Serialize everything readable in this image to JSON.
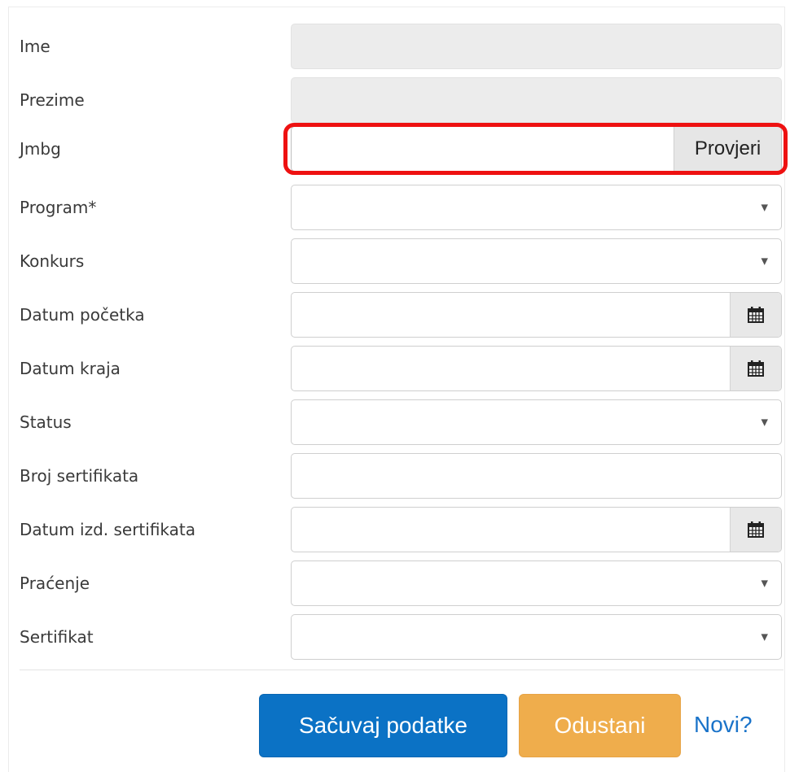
{
  "form": {
    "fields": [
      {
        "label": "Ime",
        "type": "readonly"
      },
      {
        "label": "Prezime",
        "type": "readonly"
      },
      {
        "label": "Jmbg",
        "type": "text-button",
        "button_label": "Provjeri"
      },
      {
        "label": "Program*",
        "type": "select"
      },
      {
        "label": "Konkurs",
        "type": "select"
      },
      {
        "label": "Datum početka",
        "type": "date",
        "icon": "calendar-icon"
      },
      {
        "label": "Datum kraja",
        "type": "date",
        "icon": "calendar-icon"
      },
      {
        "label": "Status",
        "type": "select"
      },
      {
        "label": "Broj sertifikata",
        "type": "text"
      },
      {
        "label": "Datum izd. sertifikata",
        "type": "date",
        "icon": "calendar-icon"
      },
      {
        "label": "Praćenje",
        "type": "select"
      },
      {
        "label": "Sertifikat",
        "type": "select"
      }
    ],
    "caret_glyph": "▼"
  },
  "actions": {
    "save_label": "Sačuvaj podatke",
    "cancel_label": "Odustani",
    "new_label": "Novi?"
  },
  "colors": {
    "primary": "#0b72c5",
    "warning": "#efad4c",
    "link": "#1a73c9",
    "highlight": "#ee1111"
  }
}
